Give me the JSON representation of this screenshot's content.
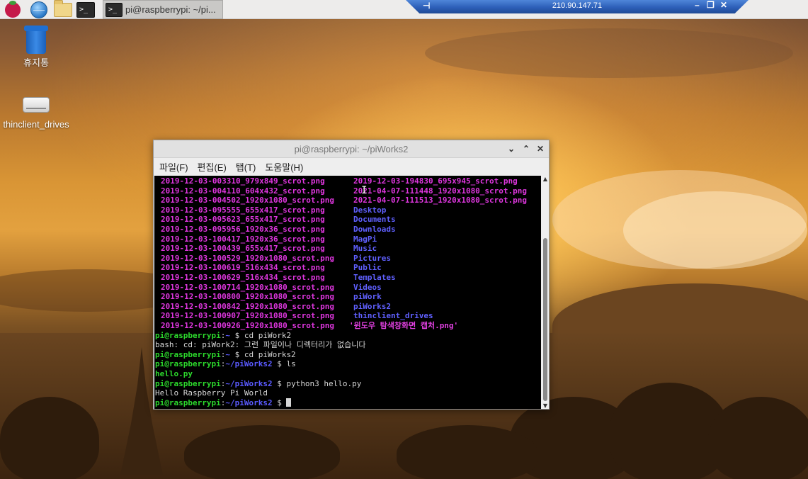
{
  "taskbar": {
    "task_title": "pi@raspberrypi: ~/pi...",
    "icons": [
      "raspberry-menu-icon",
      "browser-globe-icon",
      "file-manager-icon",
      "terminal-icon"
    ]
  },
  "rdp_bar": {
    "address": "210.90.147.71",
    "minimize": "–",
    "restore": "❐",
    "close": "✕",
    "pin": "⊣"
  },
  "desktop": {
    "icons": [
      {
        "label": "휴지통"
      },
      {
        "label": "thinclient_drives"
      }
    ]
  },
  "terminal_window": {
    "title": "pi@raspberrypi: ~/piWorks2",
    "menu": [
      "파일(F)",
      "편집(E)",
      "탭(T)",
      "도움말(H)"
    ],
    "ls_rows": [
      {
        "left": "2019-12-03-003310_979x849_scrot.png",
        "right": "2019-12-03-194830_695x945_scrot.png",
        "right_type": "png"
      },
      {
        "left": "2019-12-03-004110_604x432_scrot.png",
        "right": "2021-04-07-111448_1920x1080_scrot.png",
        "right_type": "png"
      },
      {
        "left": "2019-12-03-004502_1920x1080_scrot.png",
        "right": "2021-04-07-111513_1920x1080_scrot.png",
        "right_type": "png"
      },
      {
        "left": "2019-12-03-095555_655x417_scrot.png",
        "right": "Desktop",
        "right_type": "dir"
      },
      {
        "left": "2019-12-03-095623_655x417_scrot.png",
        "right": "Documents",
        "right_type": "dir"
      },
      {
        "left": "2019-12-03-095956_1920x36_scrot.png",
        "right": "Downloads",
        "right_type": "dir"
      },
      {
        "left": "2019-12-03-100417_1920x36_scrot.png",
        "right": "MagPi",
        "right_type": "dir"
      },
      {
        "left": "2019-12-03-100439_655x417_scrot.png",
        "right": "Music",
        "right_type": "dir"
      },
      {
        "left": "2019-12-03-100529_1920x1080_scrot.png",
        "right": "Pictures",
        "right_type": "dir"
      },
      {
        "left": "2019-12-03-100619_516x434_scrot.png",
        "right": "Public",
        "right_type": "dir"
      },
      {
        "left": "2019-12-03-100629_516x434_scrot.png",
        "right": "Templates",
        "right_type": "dir"
      },
      {
        "left": "2019-12-03-100714_1920x1080_scrot.png",
        "right": "Videos",
        "right_type": "dir"
      },
      {
        "left": "2019-12-03-100800_1920x1080_scrot.png",
        "right": "piWork",
        "right_type": "dir"
      },
      {
        "left": "2019-12-03-100842_1920x1080_scrot.png",
        "right": "piWorks2",
        "right_type": "dir"
      },
      {
        "left": "2019-12-03-100907_1920x1080_scrot.png",
        "right": "thinclient_drives",
        "right_type": "dir"
      },
      {
        "left": "2019-12-03-100926_1920x1080_scrot.png",
        "right": "'윈도우 탐색창화면 캡처.png'",
        "right_type": "quoted"
      }
    ],
    "history": [
      {
        "user": "pi@raspberrypi",
        "sep": ":",
        "path": "~",
        "cmd": " $ cd piWork2"
      },
      {
        "output": "bash: cd: piWork2: 그런 파일이나 디렉터리가 없습니다"
      },
      {
        "user": "pi@raspberrypi",
        "sep": ":",
        "path": "~",
        "cmd": " $ cd piWorks2"
      },
      {
        "user": "pi@raspberrypi",
        "sep": ":",
        "path": "~/piWorks2",
        "cmd": " $ ls"
      },
      {
        "exec": "hello.py"
      },
      {
        "user": "pi@raspberrypi",
        "sep": ":",
        "path": "~/piWorks2",
        "cmd": " $ python3 hello.py"
      },
      {
        "output": "Hello Raspberry Pi World"
      },
      {
        "user": "pi@raspberrypi",
        "sep": ":",
        "path": "~/piWorks2",
        "cmd": " $ ",
        "cursor": true
      }
    ]
  }
}
